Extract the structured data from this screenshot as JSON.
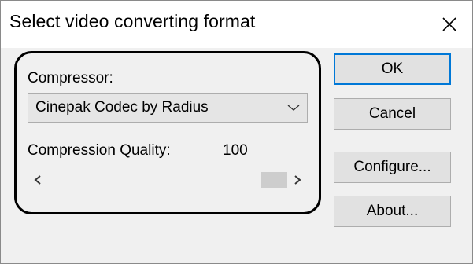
{
  "window": {
    "title": "Select video converting format",
    "close_icon": "close-icon"
  },
  "compressor": {
    "label": "Compressor:",
    "selected": "Cinepak Codec by Radius",
    "dropdown_icon": "chevron-down-icon"
  },
  "quality": {
    "label": "Compression Quality:",
    "value": "100",
    "slider_fraction": 1.0,
    "left_icon": "chevron-left-icon",
    "right_icon": "chevron-right-icon"
  },
  "buttons": {
    "ok": "OK",
    "cancel": "Cancel",
    "configure": "Configure...",
    "about": "About..."
  },
  "colors": {
    "default_button_border": "#0078d7",
    "annotation_outline": "#000000"
  }
}
